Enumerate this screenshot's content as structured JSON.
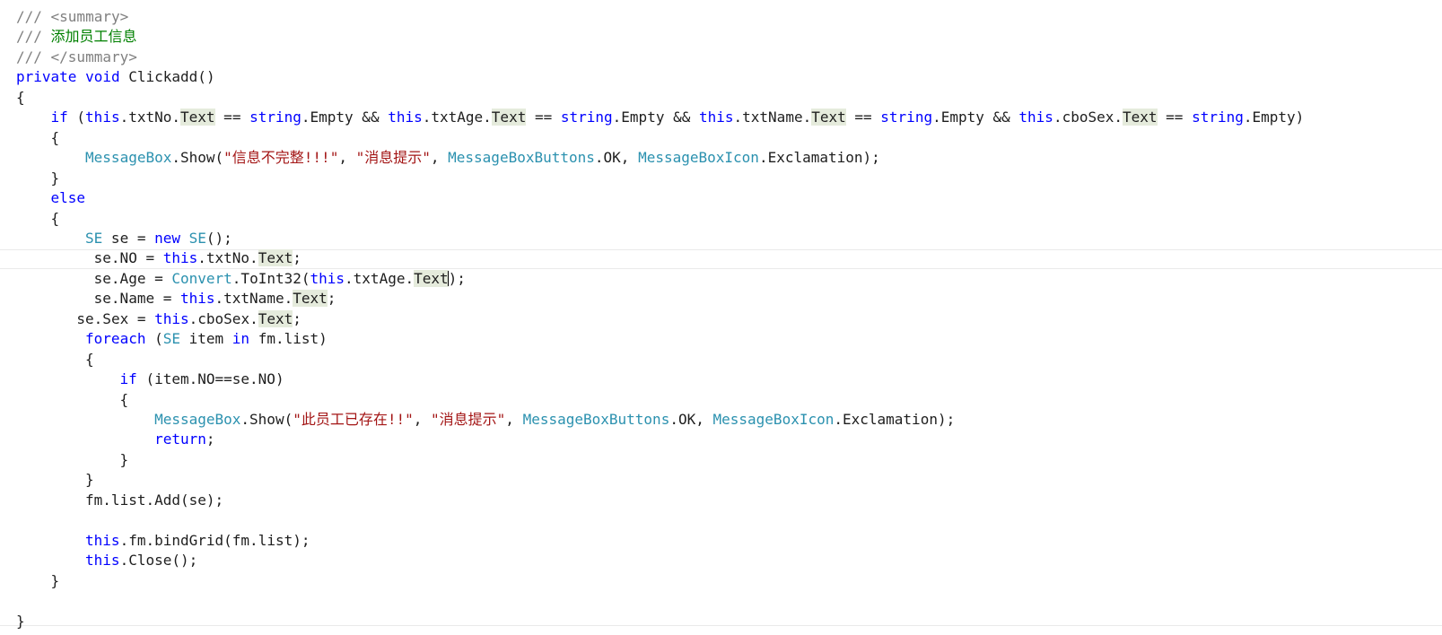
{
  "editor": {
    "caret_line": 13,
    "lines": [
      {
        "indent": "",
        "tokens": [
          {
            "c": "doc",
            "t": "/// <summary>"
          }
        ]
      },
      {
        "indent": "",
        "tokens": [
          {
            "c": "doc",
            "t": "/// "
          },
          {
            "c": "cm",
            "t": "添加员工信息"
          }
        ]
      },
      {
        "indent": "",
        "tokens": [
          {
            "c": "doc",
            "t": "/// </summary>"
          }
        ]
      },
      {
        "indent": "",
        "tokens": [
          {
            "c": "kw",
            "t": "private"
          },
          {
            "c": "pl",
            "t": " "
          },
          {
            "c": "kw",
            "t": "void"
          },
          {
            "c": "pl",
            "t": " Clickadd()"
          }
        ]
      },
      {
        "indent": "",
        "tokens": [
          {
            "c": "pl",
            "t": "{"
          }
        ]
      },
      {
        "indent": "    ",
        "tokens": [
          {
            "c": "kw",
            "t": "if"
          },
          {
            "c": "pl",
            "t": " ("
          },
          {
            "c": "kw",
            "t": "this"
          },
          {
            "c": "pl",
            "t": ".txtNo."
          },
          {
            "c": "hl",
            "t": "Text"
          },
          {
            "c": "pl",
            "t": " == "
          },
          {
            "c": "kw",
            "t": "string"
          },
          {
            "c": "pl",
            "t": ".Empty && "
          },
          {
            "c": "kw",
            "t": "this"
          },
          {
            "c": "pl",
            "t": ".txtAge."
          },
          {
            "c": "hl",
            "t": "Text"
          },
          {
            "c": "pl",
            "t": " == "
          },
          {
            "c": "kw",
            "t": "string"
          },
          {
            "c": "pl",
            "t": ".Empty && "
          },
          {
            "c": "kw",
            "t": "this"
          },
          {
            "c": "pl",
            "t": ".txtName."
          },
          {
            "c": "hl",
            "t": "Text"
          },
          {
            "c": "pl",
            "t": " == "
          },
          {
            "c": "kw",
            "t": "string"
          },
          {
            "c": "pl",
            "t": ".Empty && "
          },
          {
            "c": "kw",
            "t": "this"
          },
          {
            "c": "pl",
            "t": ".cboSex."
          },
          {
            "c": "hl",
            "t": "Text"
          },
          {
            "c": "pl",
            "t": " == "
          },
          {
            "c": "kw",
            "t": "string"
          },
          {
            "c": "pl",
            "t": ".Empty)"
          }
        ]
      },
      {
        "indent": "    ",
        "tokens": [
          {
            "c": "pl",
            "t": "{"
          }
        ]
      },
      {
        "indent": "        ",
        "tokens": [
          {
            "c": "ty",
            "t": "MessageBox"
          },
          {
            "c": "pl",
            "t": ".Show("
          },
          {
            "c": "str",
            "t": "\"信息不完整!!!\""
          },
          {
            "c": "pl",
            "t": ", "
          },
          {
            "c": "str",
            "t": "\"消息提示\""
          },
          {
            "c": "pl",
            "t": ", "
          },
          {
            "c": "ty",
            "t": "MessageBoxButtons"
          },
          {
            "c": "pl",
            "t": ".OK, "
          },
          {
            "c": "ty",
            "t": "MessageBoxIcon"
          },
          {
            "c": "pl",
            "t": ".Exclamation);"
          }
        ]
      },
      {
        "indent": "    ",
        "tokens": [
          {
            "c": "pl",
            "t": "}"
          }
        ]
      },
      {
        "indent": "    ",
        "tokens": [
          {
            "c": "kw",
            "t": "else"
          }
        ]
      },
      {
        "indent": "    ",
        "tokens": [
          {
            "c": "pl",
            "t": "{"
          }
        ]
      },
      {
        "indent": "        ",
        "tokens": [
          {
            "c": "ty",
            "t": "SE"
          },
          {
            "c": "pl",
            "t": " se = "
          },
          {
            "c": "kw",
            "t": "new"
          },
          {
            "c": "pl",
            "t": " "
          },
          {
            "c": "ty",
            "t": "SE"
          },
          {
            "c": "pl",
            "t": "();"
          }
        ]
      },
      {
        "indent": "         ",
        "tokens": [
          {
            "c": "pl",
            "t": "se.NO = "
          },
          {
            "c": "kw",
            "t": "this"
          },
          {
            "c": "pl",
            "t": ".txtNo."
          },
          {
            "c": "hl",
            "t": "Text"
          },
          {
            "c": "pl",
            "t": ";"
          }
        ]
      },
      {
        "indent": "         ",
        "tokens": [
          {
            "c": "pl",
            "t": "se.Age = "
          },
          {
            "c": "ty",
            "t": "Convert"
          },
          {
            "c": "pl",
            "t": ".ToInt32("
          },
          {
            "c": "kw",
            "t": "this"
          },
          {
            "c": "pl",
            "t": ".txtAge."
          },
          {
            "c": "hl",
            "t": "Text"
          },
          {
            "c": "pl",
            "t": ");"
          }
        ]
      },
      {
        "indent": "         ",
        "tokens": [
          {
            "c": "pl",
            "t": "se.Name = "
          },
          {
            "c": "kw",
            "t": "this"
          },
          {
            "c": "pl",
            "t": ".txtName."
          },
          {
            "c": "hl",
            "t": "Text"
          },
          {
            "c": "pl",
            "t": ";"
          }
        ]
      },
      {
        "indent": "       ",
        "tokens": [
          {
            "c": "pl",
            "t": "se.Sex = "
          },
          {
            "c": "kw",
            "t": "this"
          },
          {
            "c": "pl",
            "t": ".cboSex."
          },
          {
            "c": "hl",
            "t": "Text"
          },
          {
            "c": "pl",
            "t": ";"
          }
        ]
      },
      {
        "indent": "        ",
        "tokens": [
          {
            "c": "kw",
            "t": "foreach"
          },
          {
            "c": "pl",
            "t": " ("
          },
          {
            "c": "ty",
            "t": "SE"
          },
          {
            "c": "pl",
            "t": " item "
          },
          {
            "c": "kw",
            "t": "in"
          },
          {
            "c": "pl",
            "t": " fm.list)"
          }
        ]
      },
      {
        "indent": "        ",
        "tokens": [
          {
            "c": "pl",
            "t": "{"
          }
        ]
      },
      {
        "indent": "            ",
        "tokens": [
          {
            "c": "kw",
            "t": "if"
          },
          {
            "c": "pl",
            "t": " (item.NO==se.NO)"
          }
        ]
      },
      {
        "indent": "            ",
        "tokens": [
          {
            "c": "pl",
            "t": "{"
          }
        ]
      },
      {
        "indent": "                ",
        "tokens": [
          {
            "c": "ty",
            "t": "MessageBox"
          },
          {
            "c": "pl",
            "t": ".Show("
          },
          {
            "c": "str",
            "t": "\"此员工已存在!!\""
          },
          {
            "c": "pl",
            "t": ", "
          },
          {
            "c": "str",
            "t": "\"消息提示\""
          },
          {
            "c": "pl",
            "t": ", "
          },
          {
            "c": "ty",
            "t": "MessageBoxButtons"
          },
          {
            "c": "pl",
            "t": ".OK, "
          },
          {
            "c": "ty",
            "t": "MessageBoxIcon"
          },
          {
            "c": "pl",
            "t": ".Exclamation);"
          }
        ]
      },
      {
        "indent": "                ",
        "tokens": [
          {
            "c": "kw",
            "t": "return"
          },
          {
            "c": "pl",
            "t": ";"
          }
        ]
      },
      {
        "indent": "            ",
        "tokens": [
          {
            "c": "pl",
            "t": "}"
          }
        ]
      },
      {
        "indent": "        ",
        "tokens": [
          {
            "c": "pl",
            "t": "}"
          }
        ]
      },
      {
        "indent": "        ",
        "tokens": [
          {
            "c": "pl",
            "t": "fm.list.Add(se);"
          }
        ]
      },
      {
        "indent": "",
        "tokens": []
      },
      {
        "indent": "        ",
        "tokens": [
          {
            "c": "kw",
            "t": "this"
          },
          {
            "c": "pl",
            "t": ".fm.bindGrid(fm.list);"
          }
        ]
      },
      {
        "indent": "        ",
        "tokens": [
          {
            "c": "kw",
            "t": "this"
          },
          {
            "c": "pl",
            "t": ".Close();"
          }
        ]
      },
      {
        "indent": "    ",
        "tokens": [
          {
            "c": "pl",
            "t": "}"
          }
        ]
      },
      {
        "indent": "",
        "tokens": []
      },
      {
        "indent": "",
        "tokens": [
          {
            "c": "pl",
            "t": "}"
          }
        ]
      }
    ]
  }
}
